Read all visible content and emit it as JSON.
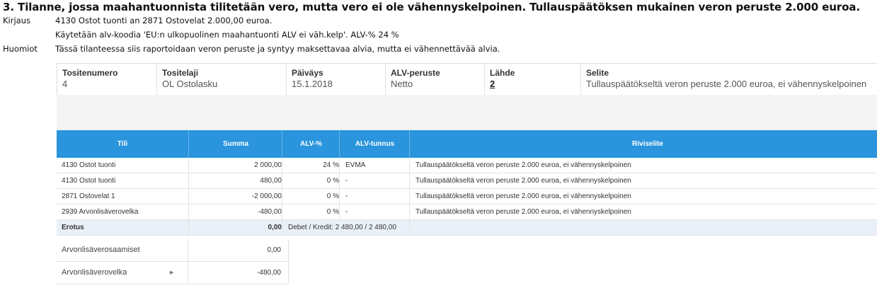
{
  "heading": "3. Tilanne, jossa maahantuonnista tilitetään vero, mutta vero ei ole vähennyskelpoinen. Tullauspäätöksen mukainen veron peruste 2.000 euroa.",
  "notes": {
    "kirjaus_label": "Kirjaus",
    "kirjaus_line1": "4130 Ostot tuonti an 2871 Ostovelat 2.000,00 euroa.",
    "kirjaus_line2": "Käytetään alv-koodia 'EU:n ulkopuolinen maahantuonti ALV ei väh.kelp'. ALV-% 24 %",
    "huomiot_label": "Huomiot",
    "huomiot_text": "Tässä tilanteessa siis raportoidaan veron peruste ja syntyy maksettavaa alvia, mutta ei vähennettävää alvia."
  },
  "voucher": {
    "tositenumero_label": "Tositenumero",
    "tositenumero_value": "4",
    "tositelaji_label": "Tositelaji",
    "tositelaji_value": "OL Ostolasku",
    "paivays_label": "Päiväys",
    "paivays_value": "15.1.2018",
    "alvperuste_label": "ALV-peruste",
    "alvperuste_value": "Netto",
    "lahde_label": "Lähde",
    "lahde_value": "2",
    "selite_label": "Selite",
    "selite_value": "Tullauspäätökseltä veron peruste 2.000 euroa, ei vähennyskelpoinen"
  },
  "grid": {
    "headers": {
      "tili": "Tili",
      "summa": "Summa",
      "alv": "ALV-%",
      "tunnus": "ALV-tunnus",
      "riviselite": "Riviselite"
    },
    "rows": [
      {
        "tili": "4130 Ostot tuonti",
        "summa": "2 000,00",
        "alv": "24 %",
        "tunnus": "EVMA",
        "selite": "Tullauspäätökseltä veron peruste 2.000 euroa, ei vähennyskelpoinen"
      },
      {
        "tili": "4130 Ostot tuonti",
        "summa": "480,00",
        "alv": "0 %",
        "tunnus": "-",
        "selite": "Tullauspäätökseltä veron peruste 2.000 euroa, ei vähennyskelpoinen"
      },
      {
        "tili": "2871 Ostovelat 1",
        "summa": "-2 000,00",
        "alv": "0 %",
        "tunnus": "-",
        "selite": "Tullauspäätökseltä veron peruste 2.000 euroa, ei vähennyskelpoinen"
      },
      {
        "tili": "2939 Arvonlisäverovelka",
        "summa": "-480,00",
        "alv": "0 %",
        "tunnus": "-",
        "selite": "Tullauspäätökseltä veron peruste 2.000 euroa, ei vähennyskelpoinen"
      }
    ],
    "erotus": {
      "label": "Erotus",
      "summa": "0,00",
      "debet_kredit": "Debet / Kredit:   2 480,00 / 2 480,00"
    },
    "summary": [
      {
        "label": "Arvonlisäverosaamiset",
        "value": "0,00"
      },
      {
        "label": "Arvonlisäverovelka",
        "value": "-480,00"
      }
    ]
  }
}
